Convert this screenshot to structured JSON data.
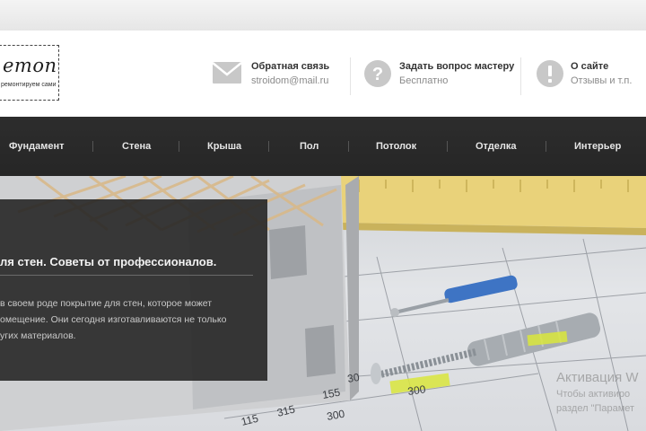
{
  "logo": {
    "word": "emont",
    "subtitle": "ремонтируем сами"
  },
  "contacts": [
    {
      "icon": "envelope-icon",
      "title": "Обратная связь",
      "sub": "stroidom@mail.ru"
    },
    {
      "icon": "question-icon",
      "title": "Задать вопрос мастеру",
      "sub": "Бесплатно"
    },
    {
      "icon": "info-icon",
      "title": "О сайте",
      "sub": "Отзывы и т.п."
    }
  ],
  "nav": {
    "items": [
      "Фундамент",
      "Стена",
      "Крыша",
      "Пол",
      "Потолок",
      "Отделка",
      "Интерьер"
    ]
  },
  "hero": {
    "title": "ля стен. Советы от профессионалов.",
    "lines": [
      "в своем роде покрытие для стен, которое может",
      "омещение. Они сегодня изготавливаются не только",
      "угих материалов."
    ],
    "plan_labels": [
      "300",
      "155",
      "115",
      "315",
      "30",
      "300"
    ]
  },
  "watermark": {
    "title": "Активация W",
    "line1": "Чтобы активиро",
    "line2": "раздел \"Парамет"
  },
  "colors": {
    "nav_bg": "#2b2b2b",
    "accent_yellow": "#d9e63c",
    "icon_gray": "#c8c8c8"
  }
}
